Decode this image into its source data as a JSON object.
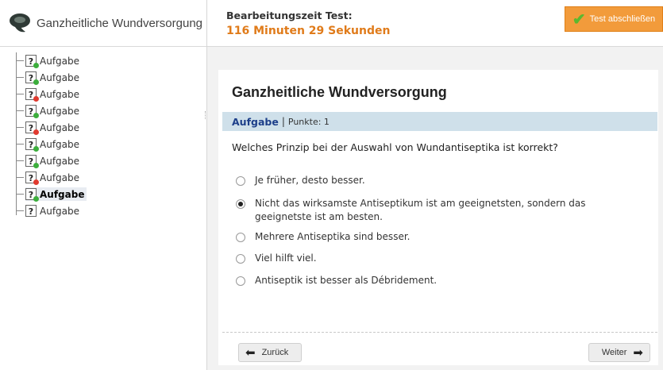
{
  "sidebar": {
    "title": "Ganzheitliche Wundversorgung",
    "icon": "bandage-logo-icon",
    "items": [
      {
        "label": "Aufgabe",
        "icon_glyph": "?",
        "status": "answered",
        "status_color": "#3cae3c",
        "current": false
      },
      {
        "label": "Aufgabe",
        "icon_glyph": "?",
        "status": "answered",
        "status_color": "#3cae3c",
        "current": false
      },
      {
        "label": "Aufgabe",
        "icon_glyph": "?",
        "status": "unanswered",
        "status_color": "#e03a2f",
        "current": false
      },
      {
        "label": "Aufgabe",
        "icon_glyph": "?",
        "status": "answered",
        "status_color": "#3cae3c",
        "current": false
      },
      {
        "label": "Aufgabe",
        "icon_glyph": "?",
        "status": "unanswered",
        "status_color": "#e03a2f",
        "current": false
      },
      {
        "label": "Aufgabe",
        "icon_glyph": "?",
        "status": "answered",
        "status_color": "#3cae3c",
        "current": false
      },
      {
        "label": "Aufgabe",
        "icon_glyph": "?",
        "status": "answered",
        "status_color": "#3cae3c",
        "current": false
      },
      {
        "label": "Aufgabe",
        "icon_glyph": "?",
        "status": "unanswered",
        "status_color": "#e03a2f",
        "current": false
      },
      {
        "label": "Aufgabe",
        "icon_glyph": "?",
        "status": "answered",
        "status_color": "#3cae3c",
        "current": true
      },
      {
        "label": "Aufgabe",
        "icon_glyph": "?",
        "status": "none",
        "status_color": "",
        "current": false
      }
    ]
  },
  "header": {
    "timer_label": "Bearbeitungszeit Test:",
    "timer_value": "116 Minuten 29 Sekunden",
    "finish_button": "Test abschließen",
    "finish_color": "#f29b3b"
  },
  "question": {
    "title": "Ganzheitliche Wundversorgung",
    "type": "Aufgabe",
    "separator": "|",
    "points": "Punkte: 1",
    "text": "Welches Prinzip bei der Auswahl von Wundantiseptika ist korrekt?",
    "options": [
      {
        "text": "Je früher, desto besser.",
        "checked": false
      },
      {
        "text": "Nicht das wirksamste Antiseptikum ist am geeignetsten, sondern das geeignetste ist am besten.",
        "checked": true
      },
      {
        "text": "Mehrere Antiseptika sind besser.",
        "checked": false
      },
      {
        "text": "Viel hilft viel.",
        "checked": false
      },
      {
        "text": "Antiseptik ist besser als Débridement.",
        "checked": false
      }
    ]
  },
  "navigation": {
    "back_label": "Zurück",
    "next_label": "Weiter"
  }
}
